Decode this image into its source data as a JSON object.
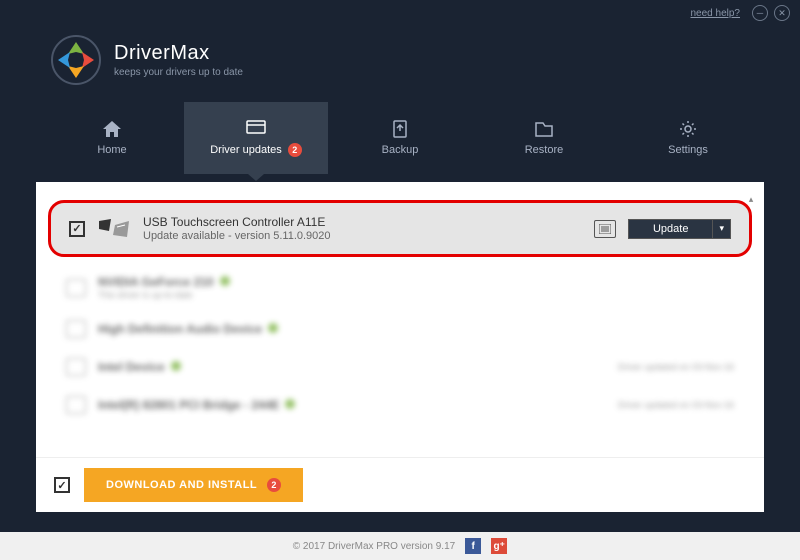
{
  "titlebar": {
    "help": "need help?"
  },
  "brand": {
    "name": "DriverMax",
    "tagline": "keeps your drivers up to date"
  },
  "nav": {
    "home": "Home",
    "updates": "Driver updates",
    "updates_badge": "2",
    "backup": "Backup",
    "restore": "Restore",
    "settings": "Settings"
  },
  "driver": {
    "name": "USB Touchscreen Controller A11E",
    "status": "Update available - version 5.11.0.9020",
    "button": "Update"
  },
  "blurred_items": [
    {
      "name": "NVIDIA GeForce 210",
      "sub": "This driver is up-to-date"
    },
    {
      "name": "High Definition Audio Device",
      "sub": ""
    },
    {
      "name": "Intel Device",
      "sub": "",
      "right": "Driver updated on 03-Nov-16"
    },
    {
      "name": "Intel(R) 82801 PCI Bridge - 244E",
      "sub": "",
      "right": "Driver updated on 03-Nov-16"
    }
  ],
  "download": {
    "label": "DOWNLOAD AND INSTALL",
    "badge": "2"
  },
  "footer": {
    "copyright": "© 2017 DriverMax PRO version 9.17"
  }
}
